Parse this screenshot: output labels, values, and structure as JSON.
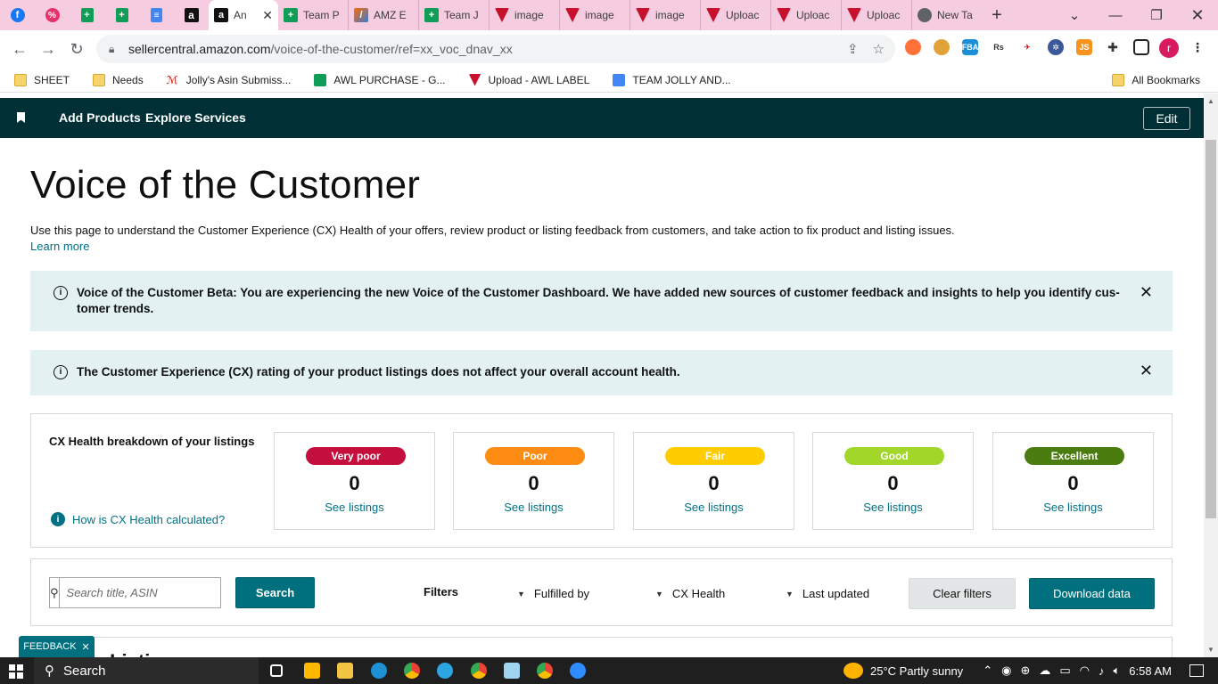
{
  "browser": {
    "tabs": [
      {
        "label": "An",
        "icon": "amazon-icon",
        "active": true
      },
      {
        "label": "Team P",
        "icon": "sheets-icon"
      },
      {
        "label": "AMZ E",
        "icon": "amz-icon"
      },
      {
        "label": "Team J",
        "icon": "sheets-icon"
      },
      {
        "label": "image",
        "icon": "shield-icon"
      },
      {
        "label": "image",
        "icon": "shield-icon"
      },
      {
        "label": "image",
        "icon": "shield-icon"
      },
      {
        "label": "Uploac",
        "icon": "shield-icon"
      },
      {
        "label": "Uploac",
        "icon": "shield-icon"
      },
      {
        "label": "Uploac",
        "icon": "shield-icon"
      },
      {
        "label": "New Ta",
        "icon": "chrome-icon"
      }
    ],
    "url_host": "sellercentral.amazon.com",
    "url_path": "/voice-of-the-customer/ref=xx_voc_dnav_xx",
    "profile_initial": "r",
    "bookmarks": [
      {
        "label": "SHEET",
        "icon": "folder-icon"
      },
      {
        "label": "Needs",
        "icon": "folder-icon"
      },
      {
        "label": "Jolly's Asin Submiss...",
        "icon": "chart-icon"
      },
      {
        "label": "AWL PURCHASE - G...",
        "icon": "sheets-icon"
      },
      {
        "label": "Upload - AWL LABEL",
        "icon": "shield-icon"
      },
      {
        "label": "TEAM JOLLY AND...",
        "icon": "docs-icon"
      }
    ],
    "all_bookmarks": "All Bookmarks"
  },
  "header": {
    "add_products": "Add Products",
    "explore_services": "Explore Services",
    "edit": "Edit"
  },
  "page": {
    "title": "Voice of the Customer",
    "description": "Use this page to understand the Customer Experience (CX) Health of your offers, review product or listing feedback from customers, and take action to fix product and listing issues.",
    "learn_more": "Learn more"
  },
  "alerts": [
    {
      "text": "Voice of the Customer Beta: You are experiencing the new Voice of the Customer Dashboard. We have added new sources of customer feedback and insights to help you identify cus- tomer trends."
    },
    {
      "text": "The Customer Experience (CX) rating of your product listings does not affect your overall account health."
    }
  ],
  "cx_health": {
    "title": "CX Health breakdown of your listings",
    "help_link": "How is CX Health calculated?",
    "tiles": [
      {
        "label": "Very poor",
        "count": "0",
        "link": "See listings",
        "color": "#c40e3c",
        "text_color": "#ffffff"
      },
      {
        "label": "Poor",
        "count": "0",
        "link": "See listings",
        "color": "#ff8c12",
        "text_color": "#ffffff"
      },
      {
        "label": "Fair",
        "count": "0",
        "link": "See listings",
        "color": "#ffcc00",
        "text_color": "#ffffff"
      },
      {
        "label": "Good",
        "count": "0",
        "link": "See listings",
        "color": "#a2d729",
        "text_color": "#ffffff"
      },
      {
        "label": "Excellent",
        "count": "0",
        "link": "See listings",
        "color": "#4b7c0f",
        "text_color": "#ffffff"
      }
    ]
  },
  "search": {
    "placeholder": "Search title, ASIN",
    "button": "Search",
    "filters_label": "Filters",
    "dropdowns": [
      "Fulfilled by",
      "CX Health",
      "Last updated"
    ],
    "clear_filters": "Clear filters",
    "download": "Download data"
  },
  "listings_heading": "ur Listings",
  "feedback": "FEEDBACK",
  "taskbar": {
    "search": "Search",
    "weather": "25°C  Partly sunny",
    "time": "6:58 AM"
  }
}
